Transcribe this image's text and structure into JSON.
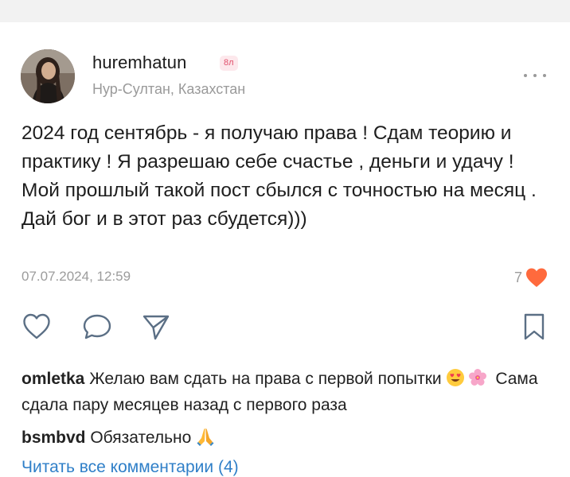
{
  "post": {
    "username": "huremhatun",
    "level_badge": "8л",
    "location": "Нур-Султан, Казахстан",
    "text": "2024 год сентябрь - я получаю права ! Сдам теорию и практику ! Я разрешаю себе счастье , деньги и удачу ! Мой прошлый такой пост сбылся с точностью на месяц . Дай бог и в этот раз сбудется)))",
    "date": "07.07.2024, 12:59",
    "likes_count": "7"
  },
  "icons": {
    "more": "more-dots-icon",
    "like": "heart-outline-icon",
    "liked": "heart-filled-icon",
    "comment": "comment-bubble-icon",
    "share": "send-icon",
    "bookmark": "bookmark-icon"
  },
  "colors": {
    "heart": "#ff6a3d",
    "link": "#2f7fc8",
    "meta": "#9c9c9c",
    "badge_text": "#e0506c",
    "badge_bg": "#fde8ec"
  },
  "comments": [
    {
      "author": "omletka",
      "text_part1": " Желаю вам сдать на права с первой попытки ",
      "emojis": [
        "smiling-face-with-heart-eyes",
        "cherry-blossom"
      ],
      "text_part2": " Сама сдала пару месяцев назад с первого раза"
    },
    {
      "author": "bsmbvd",
      "text": " Обязательно ",
      "emojis": [
        "folded-hands"
      ]
    }
  ],
  "read_all_comments": "Читать все комментарии (4)"
}
